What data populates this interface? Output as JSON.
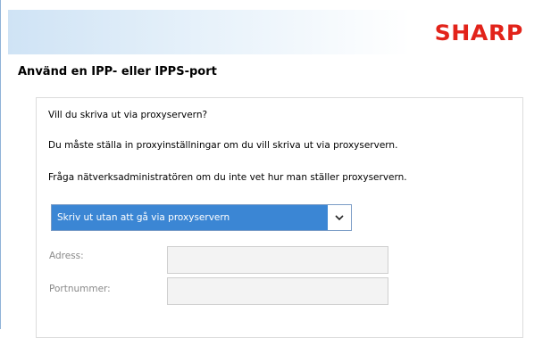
{
  "header": {
    "brand": "SHARP"
  },
  "page": {
    "title": "Använd en IPP- eller IPPS-port"
  },
  "body": {
    "question": "Vill du skriva ut via proxyservern?",
    "info_1": "Du måste ställa in proxyinställningar om du vill skriva ut via proxyservern.",
    "info_2": "Fråga nätverksadministratören om du inte vet hur man ställer proxyservern."
  },
  "proxy_select": {
    "selected": "Skriv ut utan att gå via proxyservern",
    "dropdown_icon": "chevron-down-icon",
    "highlight_color": "#3b86d4"
  },
  "fields": {
    "address_label": "Adress:",
    "address_value": "",
    "port_label": "Portnummer:",
    "port_value": ""
  }
}
